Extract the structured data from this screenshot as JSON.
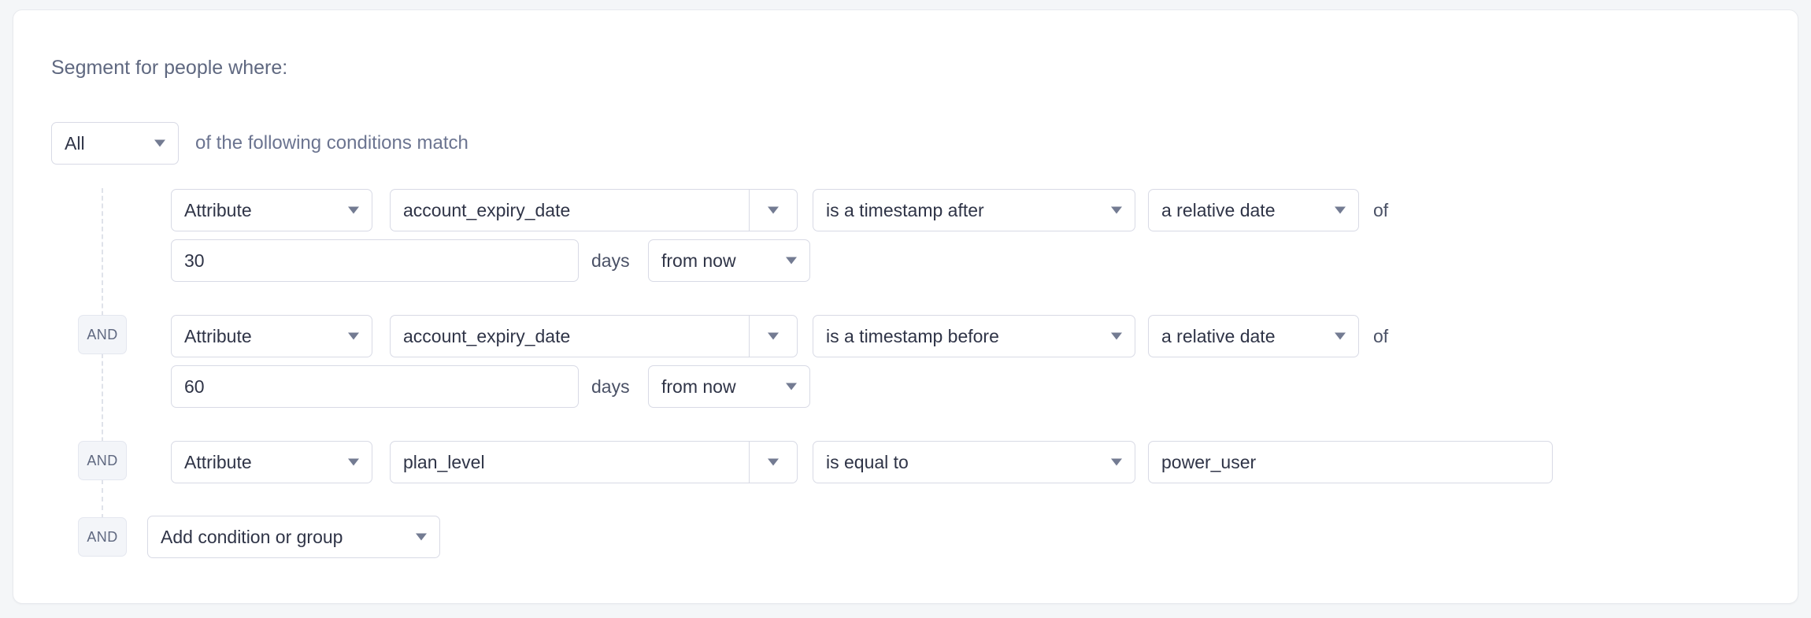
{
  "panel": {
    "heading": "Segment for people where:"
  },
  "match": {
    "selector_value": "All",
    "suffix_text": "of the following conditions match"
  },
  "connectors": {
    "and_label": "AND"
  },
  "conditions": [
    {
      "source_type": "Attribute",
      "attribute": "account_expiry_date",
      "operator": "is a timestamp after",
      "value_kind": "a relative date",
      "of_text": "of",
      "amount": "30",
      "unit_text": "days",
      "direction": "from now"
    },
    {
      "connector": "AND",
      "source_type": "Attribute",
      "attribute": "account_expiry_date",
      "operator": "is a timestamp before",
      "value_kind": "a relative date",
      "of_text": "of",
      "amount": "60",
      "unit_text": "days",
      "direction": "from now"
    },
    {
      "connector": "AND",
      "source_type": "Attribute",
      "attribute": "plan_level",
      "operator": "is equal to",
      "value_text": "power_user"
    }
  ],
  "add_row": {
    "connector": "AND",
    "label": "Add condition or group"
  },
  "colors": {
    "page_background": "#f4f6f8",
    "card_background": "#ffffff",
    "border": "#d8dae5",
    "heading_text": "#5f6880",
    "control_text": "#2f3447",
    "badge_background": "#f3f5f9",
    "caret": "#737b92",
    "connector_line": "#dfe2ea"
  }
}
